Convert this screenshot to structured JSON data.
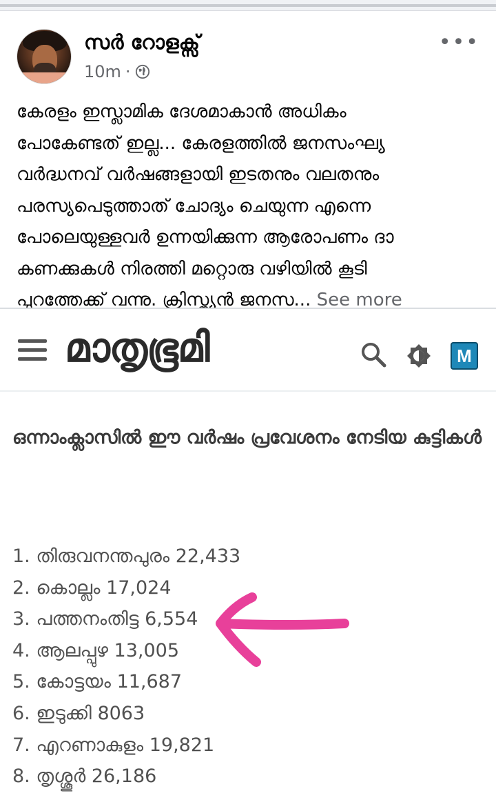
{
  "post": {
    "author": "സർ റോളക്സ്",
    "time": "10m",
    "separator": "·",
    "more_label": "•••",
    "see_more": "See more",
    "text_lines": [
      "കേരളം ഇസ്ലാമിക ദേശമാകാൻ അധികം",
      "പോകേണ്ടത് ഇല്ല... കേരളത്തിൽ ജനസംഘ്യ",
      "വർദ്ധനവ് വർഷങ്ങളായി ഇടതനും വലതനും",
      "പരസ്യപെടുത്താത് ചോദ്യം ചെയുന്ന എന്നെ",
      "പോലെയുള്ളവർ ഉന്നയിക്കുന്ന ആരോപണം ദാ",
      "കണക്കുകൾ നിരത്തി മറ്റൊരു വഴിയിൽ കൂടി",
      "പുറത്തേക്ക് വന്നു. ക്രിസ്ത്യൻ ജനസ..."
    ]
  },
  "embed": {
    "site_logo": "മാതൃഭൂമി",
    "badge": "M",
    "title": "ഒന്നാംക്ലാസിൽ ഈ വർഷം പ്രവേശനം നേടിയ കുട്ടികൾ",
    "districts": [
      {
        "num": "1.",
        "name": "തിരുവനന്തപുരം",
        "count": "22,433"
      },
      {
        "num": "2.",
        "name": "കൊല്ലം",
        "count": "17,024"
      },
      {
        "num": "3.",
        "name": "പത്തനംതിട്ട",
        "count": "6,554"
      },
      {
        "num": "4.",
        "name": "ആലപ്പുഴ",
        "count": "13,005"
      },
      {
        "num": "5.",
        "name": "കോട്ടയം",
        "count": "11,687"
      },
      {
        "num": "6.",
        "name": "ഇടുക്കി",
        "count": "8063"
      },
      {
        "num": "7.",
        "name": "എറണാകുളം",
        "count": "19,821"
      },
      {
        "num": "8.",
        "name": "തൃശ്ശൂർ",
        "count": "26,186"
      }
    ],
    "annotation_color": "#e8409a"
  }
}
